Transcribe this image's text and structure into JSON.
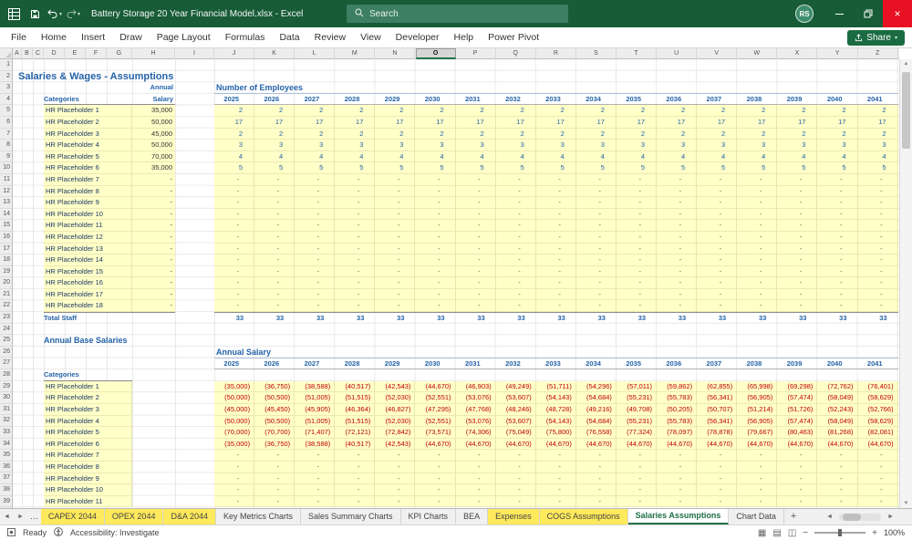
{
  "colors": {
    "titlebar_green": "#185C37",
    "accent_blue": "#2563A8",
    "input_yellow": "#FFFFC8",
    "negative_red": "#C00000",
    "active_sheet_green": "#217346",
    "sheet_tab_yellow": "#FFE95C"
  },
  "titlebar": {
    "title": "Battery Storage 20 Year Financial Model.xlsx - Excel",
    "search_placeholder": "Search",
    "avatar_initials": "RS"
  },
  "ribbon": {
    "tabs": [
      "File",
      "Home",
      "Insert",
      "Draw",
      "Page Layout",
      "Formulas",
      "Data",
      "Review",
      "View",
      "Developer",
      "Help",
      "Power Pivot"
    ],
    "share_label": "Share"
  },
  "grid": {
    "column_letters": [
      "A",
      "B",
      "C",
      "D",
      "E",
      "F",
      "G",
      "H",
      "I",
      "J",
      "K",
      "L",
      "M",
      "N",
      "O",
      "P",
      "Q",
      "R",
      "S",
      "T",
      "U",
      "V",
      "W",
      "X",
      "Y",
      "Z"
    ],
    "row_count": 39,
    "selected_column": "O"
  },
  "content": {
    "page_title": "Salaries & Wages - Assumptions",
    "staff_table": {
      "categories_header": "Categories",
      "salary_header_line1": "Annual",
      "salary_header_line2": "Salary",
      "total_label": "Total Staff",
      "rows": [
        {
          "name": "HR Placeholder 1",
          "annual_salary": "35,000",
          "employees": "2"
        },
        {
          "name": "HR Placeholder 2",
          "annual_salary": "50,000",
          "employees": "17"
        },
        {
          "name": "HR Placeholder 3",
          "annual_salary": "45,000",
          "employees": "2"
        },
        {
          "name": "HR Placeholder 4",
          "annual_salary": "50,000",
          "employees": "3"
        },
        {
          "name": "HR Placeholder 5",
          "annual_salary": "70,000",
          "employees": "4"
        },
        {
          "name": "HR Placeholder 6",
          "annual_salary": "35,000",
          "employees": "5"
        },
        {
          "name": "HR Placeholder 7",
          "annual_salary": "-",
          "employees": "-"
        },
        {
          "name": "HR Placeholder 8",
          "annual_salary": "-",
          "employees": "-"
        },
        {
          "name": "HR Placeholder 9",
          "annual_salary": "-",
          "employees": "-"
        },
        {
          "name": "HR Placeholder 10",
          "annual_salary": "-",
          "employees": "-"
        },
        {
          "name": "HR Placeholder 11",
          "annual_salary": "-",
          "employees": "-"
        },
        {
          "name": "HR Placeholder 12",
          "annual_salary": "-",
          "employees": "-"
        },
        {
          "name": "HR Placeholder 13",
          "annual_salary": "-",
          "employees": "-"
        },
        {
          "name": "HR Placeholder 14",
          "annual_salary": "-",
          "employees": "-"
        },
        {
          "name": "HR Placeholder 15",
          "annual_salary": "-",
          "employees": "-"
        },
        {
          "name": "HR Placeholder 16",
          "annual_salary": "-",
          "employees": "-"
        },
        {
          "name": "HR Placeholder 17",
          "annual_salary": "-",
          "employees": "-"
        },
        {
          "name": "HR Placeholder 18",
          "annual_salary": "-",
          "employees": "-"
        }
      ]
    },
    "employees_table": {
      "title": "Number of Employees",
      "years": [
        "2025",
        "2026",
        "2027",
        "2028",
        "2029",
        "2030",
        "2031",
        "2032",
        "2033",
        "2034",
        "2035",
        "2036",
        "2037",
        "2038",
        "2039",
        "2040",
        "2041"
      ],
      "total_per_year": "33"
    },
    "annual_base_salaries": {
      "section_title": "Annual Base Salaries",
      "categories_header": "Categories",
      "table_title": "Annual Salary",
      "years": [
        "2025",
        "2026",
        "2027",
        "2028",
        "2029",
        "2030",
        "2031",
        "2032",
        "2033",
        "2034",
        "2035",
        "2036",
        "2037",
        "2038",
        "2039",
        "2040",
        "2041"
      ],
      "rows": [
        {
          "name": "HR Placeholder 1",
          "values": [
            "(35,000)",
            "(36,750)",
            "(38,588)",
            "(40,517)",
            "(42,543)",
            "(44,670)",
            "(46,903)",
            "(49,249)",
            "(51,711)",
            "(54,296)",
            "(57,011)",
            "(59,862)",
            "(62,855)",
            "(65,998)",
            "(69,298)",
            "(72,762)",
            "(76,401)"
          ]
        },
        {
          "name": "HR Placeholder 2",
          "values": [
            "(50,000)",
            "(50,500)",
            "(51,005)",
            "(51,515)",
            "(52,030)",
            "(52,551)",
            "(53,076)",
            "(53,607)",
            "(54,143)",
            "(54,684)",
            "(55,231)",
            "(55,783)",
            "(56,341)",
            "(56,905)",
            "(57,474)",
            "(58,049)",
            "(58,629)"
          ]
        },
        {
          "name": "HR Placeholder 3",
          "values": [
            "(45,000)",
            "(45,450)",
            "(45,905)",
            "(46,364)",
            "(46,827)",
            "(47,295)",
            "(47,768)",
            "(48,246)",
            "(48,728)",
            "(49,216)",
            "(49,708)",
            "(50,205)",
            "(50,707)",
            "(51,214)",
            "(51,726)",
            "(52,243)",
            "(52,766)"
          ]
        },
        {
          "name": "HR Placeholder 4",
          "values": [
            "(50,000)",
            "(50,500)",
            "(51,005)",
            "(51,515)",
            "(52,030)",
            "(52,551)",
            "(53,076)",
            "(53,607)",
            "(54,143)",
            "(54,684)",
            "(55,231)",
            "(55,783)",
            "(56,341)",
            "(56,905)",
            "(57,474)",
            "(58,049)",
            "(58,629)"
          ]
        },
        {
          "name": "HR Placeholder 5",
          "values": [
            "(70,000)",
            "(70,700)",
            "(71,407)",
            "(72,121)",
            "(72,842)",
            "(73,571)",
            "(74,306)",
            "(75,049)",
            "(75,800)",
            "(76,558)",
            "(77,324)",
            "(78,097)",
            "(78,878)",
            "(79,667)",
            "(80,463)",
            "(81,268)",
            "(82,081)"
          ]
        },
        {
          "name": "HR Placeholder 6",
          "values": [
            "(35,000)",
            "(36,750)",
            "(38,588)",
            "(40,517)",
            "(42,543)",
            "(44,670)",
            "(44,670)",
            "(44,670)",
            "(44,670)",
            "(44,670)",
            "(44,670)",
            "(44,670)",
            "(44,670)",
            "(44,670)",
            "(44,670)",
            "(44,670)",
            "(44,670)"
          ]
        },
        {
          "name": "HR Placeholder 7",
          "values": "-"
        },
        {
          "name": "HR Placeholder 8",
          "values": "-"
        },
        {
          "name": "HR Placeholder 9",
          "values": "-"
        },
        {
          "name": "HR Placeholder 10",
          "values": "-"
        },
        {
          "name": "HR Placeholder 11",
          "values": "-"
        }
      ]
    }
  },
  "sheet_tabs": {
    "overflow_indicator": "…",
    "add_sheet_label": "+",
    "tabs": [
      {
        "label": "CAPEX 2044",
        "highlight": true
      },
      {
        "label": "OPEX 2044",
        "highlight": true
      },
      {
        "label": "D&A 2044",
        "highlight": true
      },
      {
        "label": "Key Metrics Charts",
        "highlight": false
      },
      {
        "label": "Sales Summary Charts",
        "highlight": false
      },
      {
        "label": "KPI Charts",
        "highlight": false
      },
      {
        "label": "BEA",
        "highlight": false
      },
      {
        "label": "Expenses",
        "highlight": true
      },
      {
        "label": "COGS Assumptions",
        "highlight": true
      },
      {
        "label": "Salaries Assumptions",
        "active": true
      },
      {
        "label": "Chart Data",
        "highlight": false
      }
    ]
  },
  "status_bar": {
    "mode": "Ready",
    "accessibility_label": "Accessibility: Investigate",
    "zoom_level": "100%"
  }
}
